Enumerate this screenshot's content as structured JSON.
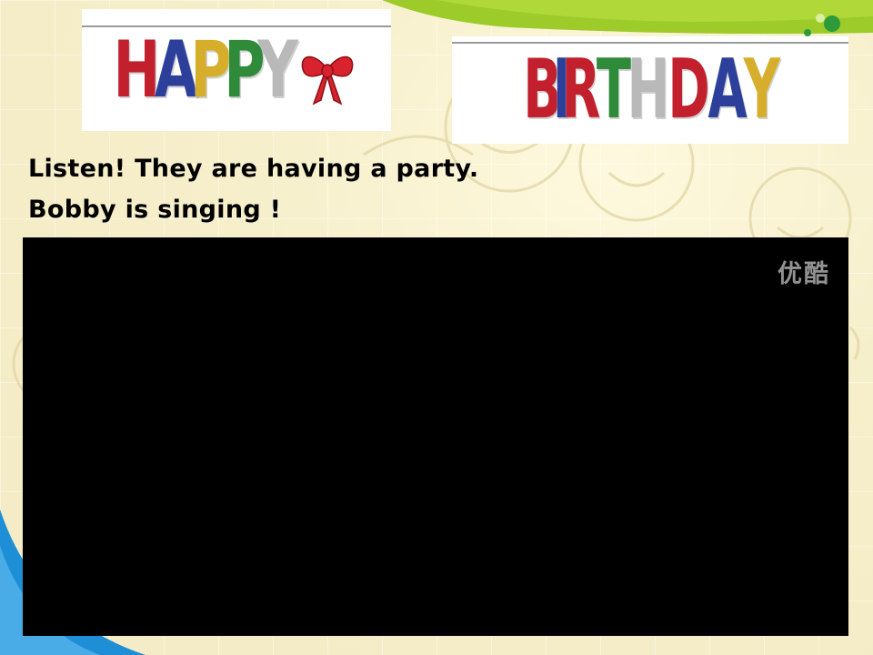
{
  "slide": {
    "banner_happy": {
      "letters": [
        {
          "char": "H",
          "color": "#c2202c"
        },
        {
          "char": "A",
          "color": "#2b3f9b"
        },
        {
          "char": "P",
          "color": "#d6ae2c"
        },
        {
          "char": "P",
          "color": "#2f8a3a"
        },
        {
          "char": "Y",
          "color": "#b9b9b9"
        }
      ],
      "ornament_icon": "bow-icon"
    },
    "banner_birthday": {
      "letters": [
        {
          "char": "B",
          "color": "#c2202c"
        },
        {
          "char": "I",
          "color": "#2b3f9b"
        },
        {
          "char": "R",
          "color": "#c2202c"
        },
        {
          "char": "T",
          "color": "#2f8a3a"
        },
        {
          "char": "H",
          "color": "#b9b9b9"
        },
        {
          "char": "D",
          "color": "#c2202c"
        },
        {
          "char": "A",
          "color": "#2b3f9b"
        },
        {
          "char": "Y",
          "color": "#d6ae2c"
        }
      ]
    },
    "caption_line1": "Listen! They are having a party.",
    "caption_line2": "Bobby is singing !",
    "video": {
      "watermark": "优酷"
    }
  },
  "colors": {
    "accent_green": "#9ccb2a",
    "accent_blue": "#1e8fd6",
    "background": "#f5eec8"
  }
}
